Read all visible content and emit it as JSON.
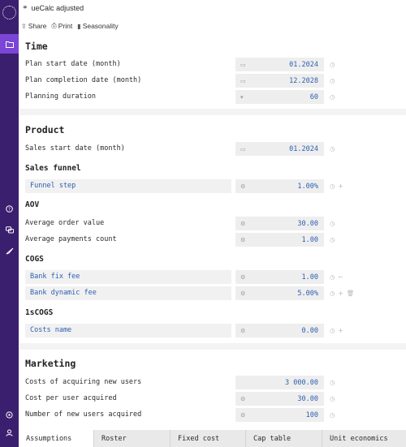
{
  "window": {
    "title": "ueCalc adjusted",
    "link_icon": "link-icon"
  },
  "toolbar": {
    "share": {
      "label": "Share",
      "icon": "share-icon"
    },
    "print": {
      "label": "Print",
      "icon": "printer-icon"
    },
    "seasonality": {
      "label": "Seasonality",
      "icon": "bar-chart-icon"
    }
  },
  "sidebar": {
    "icons": [
      "logo-icon",
      "folder-icon",
      "help-icon",
      "chat-icon",
      "rocket-icon",
      "settings-icon",
      "user-icon"
    ]
  },
  "time": {
    "title": "Time",
    "rows": [
      {
        "label": "Plan start date (month)",
        "value": "01.2024",
        "icon": "calendar-icon"
      },
      {
        "label": "Plan completion date (month)",
        "value": "12.2028",
        "icon": "calendar-icon"
      },
      {
        "label": "Planning duration",
        "value": "60",
        "icon": "dropdown-icon"
      }
    ]
  },
  "product": {
    "title": "Product",
    "sales_start": {
      "label": "Sales start date (month)",
      "value": "01.2024"
    },
    "sales_funnel": {
      "title": "Sales funnel",
      "rows": [
        {
          "label": "Funnel step",
          "value": "1.00%"
        }
      ]
    },
    "aov": {
      "title": "AOV",
      "rows": [
        {
          "label": "Average order value",
          "value": "30.00"
        },
        {
          "label": "Average payments count",
          "value": "1.00"
        }
      ]
    },
    "cogs": {
      "title": "COGS",
      "rows": [
        {
          "label": "Bank fix fee",
          "value": "1.00"
        },
        {
          "label": "Bank dynamic fee",
          "value": "5.00%"
        }
      ]
    },
    "one_s_cogs": {
      "title": "1sCOGS",
      "rows": [
        {
          "label": "Costs name",
          "value": "0.00"
        }
      ]
    }
  },
  "marketing": {
    "title": "Marketing",
    "rows": [
      {
        "label": "Costs of acquiring new users",
        "value": "3 000.00"
      },
      {
        "label": "Cost per user acquired",
        "value": "30.00"
      },
      {
        "label": "Number of new users acquired",
        "value": "100"
      }
    ]
  },
  "tabs": [
    "Assumptions",
    "Roster",
    "Fixed cost",
    "Cap table",
    "Unit economics"
  ],
  "colors": {
    "sidebar": "#3a1f6e",
    "sidebar_active": "#7b45d6",
    "value_text": "#2d5fb0"
  }
}
